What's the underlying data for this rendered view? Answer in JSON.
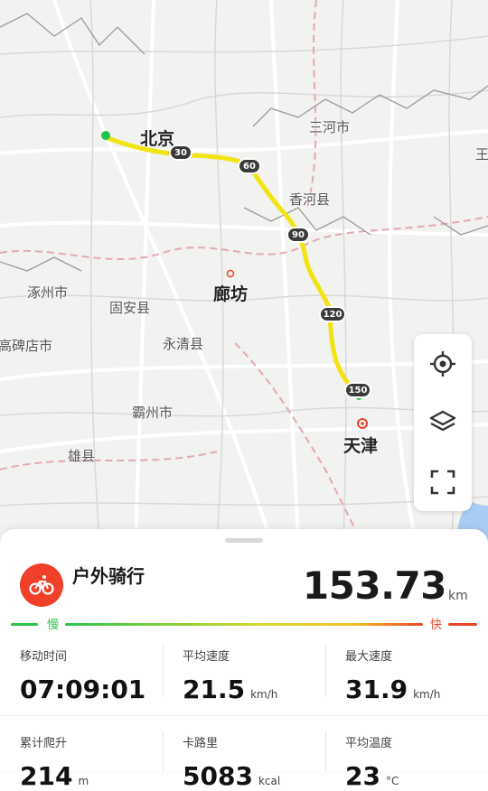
{
  "map": {
    "cities": [
      {
        "name": "北京",
        "big": true
      },
      {
        "name": "三河市",
        "big": false
      },
      {
        "name": "王",
        "big": false
      },
      {
        "name": "香河县",
        "big": false
      },
      {
        "name": "涿州市",
        "big": false
      },
      {
        "name": "固安县",
        "big": false
      },
      {
        "name": "廊坊",
        "big": true
      },
      {
        "name": "高碑店市",
        "big": false
      },
      {
        "name": "永清县",
        "big": false
      },
      {
        "name": "霸州市",
        "big": false
      },
      {
        "name": "天津",
        "big": true
      },
      {
        "name": "雄县",
        "big": false
      }
    ],
    "km_markers": [
      "30",
      "60",
      "90",
      "120",
      "150"
    ],
    "route_color": "#f2e312",
    "start_color": "#22c44a",
    "controls": [
      {
        "name": "locate-icon"
      },
      {
        "name": "layers-icon"
      },
      {
        "name": "fullscreen-icon"
      }
    ]
  },
  "activity": {
    "type": "户外骑行",
    "distance": "153.73",
    "distance_unit": "km",
    "icon": "bicycle-icon",
    "accent_color": "#f0402a"
  },
  "speed_legend": {
    "slow_label": "慢",
    "fast_label": "快",
    "slow_color": "#2bc24b",
    "fast_color": "#e8452a"
  },
  "stats": [
    {
      "label": "移动时间",
      "value": "07:09:01",
      "unit": ""
    },
    {
      "label": "平均速度",
      "value": "21.5",
      "unit": "km/h"
    },
    {
      "label": "最大速度",
      "value": "31.9",
      "unit": "km/h"
    },
    {
      "label": "累计爬升",
      "value": "214",
      "unit": "m"
    },
    {
      "label": "卡路里",
      "value": "5083",
      "unit": "kcal"
    },
    {
      "label": "平均温度",
      "value": "23",
      "unit": "°C"
    }
  ]
}
